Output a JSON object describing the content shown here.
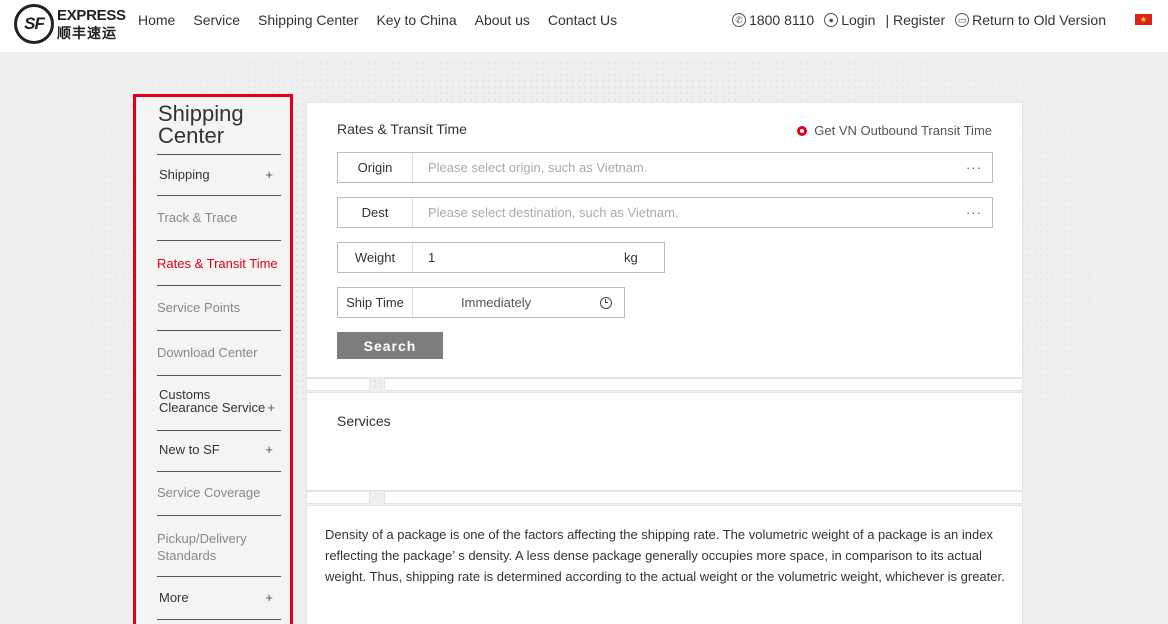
{
  "header": {
    "logo_mark": "SF",
    "logo_en": "EXPRESS",
    "logo_cn": "顺丰速运",
    "nav": [
      "Home",
      "Service",
      "Shipping Center",
      "Key to China",
      "About us",
      "Contact Us"
    ],
    "phone": "1800 8110",
    "login": "Login",
    "register": "| Register",
    "old_version": "Return to Old Version",
    "flag_color": "#da251d"
  },
  "sidebar": {
    "title_line1": "Shipping",
    "title_line2": "Center",
    "items": [
      {
        "label": "Shipping",
        "plus": "+"
      },
      {
        "label": "Track & Trace"
      },
      {
        "label": "Rates & Transit Time"
      },
      {
        "label": "Service Points"
      },
      {
        "label": "Download Center"
      },
      {
        "label_line1": "Customs",
        "label_line2": "Clearance Service",
        "plus": "+"
      },
      {
        "label": "New to SF",
        "plus": "+"
      },
      {
        "label": "Service Coverage"
      },
      {
        "label_line1": "Pickup/Delivery",
        "label_line2": "Standards"
      },
      {
        "label": "More",
        "plus": "+"
      }
    ],
    "active_color": "#e0001b"
  },
  "rates": {
    "title": "Rates & Transit Time",
    "vn_link": "Get VN Outbound Transit Time",
    "origin_label": "Origin",
    "origin_placeholder": "Please select origin, such as Vietnam.",
    "dest_label": "Dest",
    "dest_placeholder": "Please select destination, such as Vietnam.",
    "more_glyph": "···",
    "weight_label": "Weight",
    "weight_value": "1",
    "weight_unit": "kg",
    "ship_time_label": "Ship Time",
    "ship_time_value": "Immediately",
    "search_label": "Search"
  },
  "services": {
    "title": "Services"
  },
  "description": {
    "text": "Density of a package is one of the factors affecting the shipping rate. The volumetric weight of a package is an index reflecting the package’ s density. A less dense package generally occupies more space, in comparison to its actual weight. Thus, shipping rate is determined according to the actual weight or the volumetric weight, whichever is greater."
  }
}
